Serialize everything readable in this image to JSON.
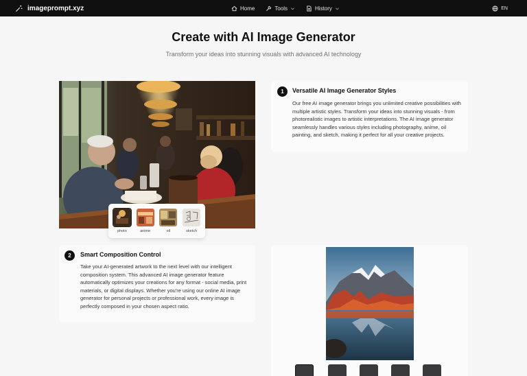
{
  "topbar": {
    "brand": "imageprompt.xyz",
    "brand_icon": "wand-icon",
    "nav": [
      {
        "label": "Home",
        "icon": "home-icon",
        "has_dropdown": false
      },
      {
        "label": "Tools",
        "icon": "wrench-icon",
        "has_dropdown": true
      },
      {
        "label": "History",
        "icon": "document-icon",
        "has_dropdown": true
      }
    ],
    "language": "EN",
    "language_icon": "globe-icon",
    "background": "#0f0f10"
  },
  "hero": {
    "title": "Create with AI Image Generator",
    "subtitle": "Transform your ideas into stunning visuals with advanced AI technology"
  },
  "styles": {
    "selected": "photo",
    "options": [
      "photo",
      "anime",
      "oil",
      "sketch"
    ]
  },
  "features": [
    {
      "number": "1",
      "title": "Versatile AI Image Generator Styles",
      "body": "Our free AI image generator brings you unlimited creative possibilities with multiple artistic styles. Transform your ideas into stunning visuals - from photorealistic images to artistic interpretations. The AI image generator seamlessly handles various styles including photography, anime, oil painting, and sketch, making it perfect for all your creative projects."
    },
    {
      "number": "2",
      "title": "Smart Composition Control",
      "body": "Take your AI-generated artwork to the next level with our intelligent composition system. This advanced AI image generator feature automatically optimizes your creations for any format - social media, print materials, or digital displays. Whether you're using our online AI image generator for personal projects or professional work, every image is perfectly composed in your chosen aspect ratio."
    }
  ],
  "composition": {
    "selected_ratio_index": 0,
    "ratio_count": 5
  }
}
